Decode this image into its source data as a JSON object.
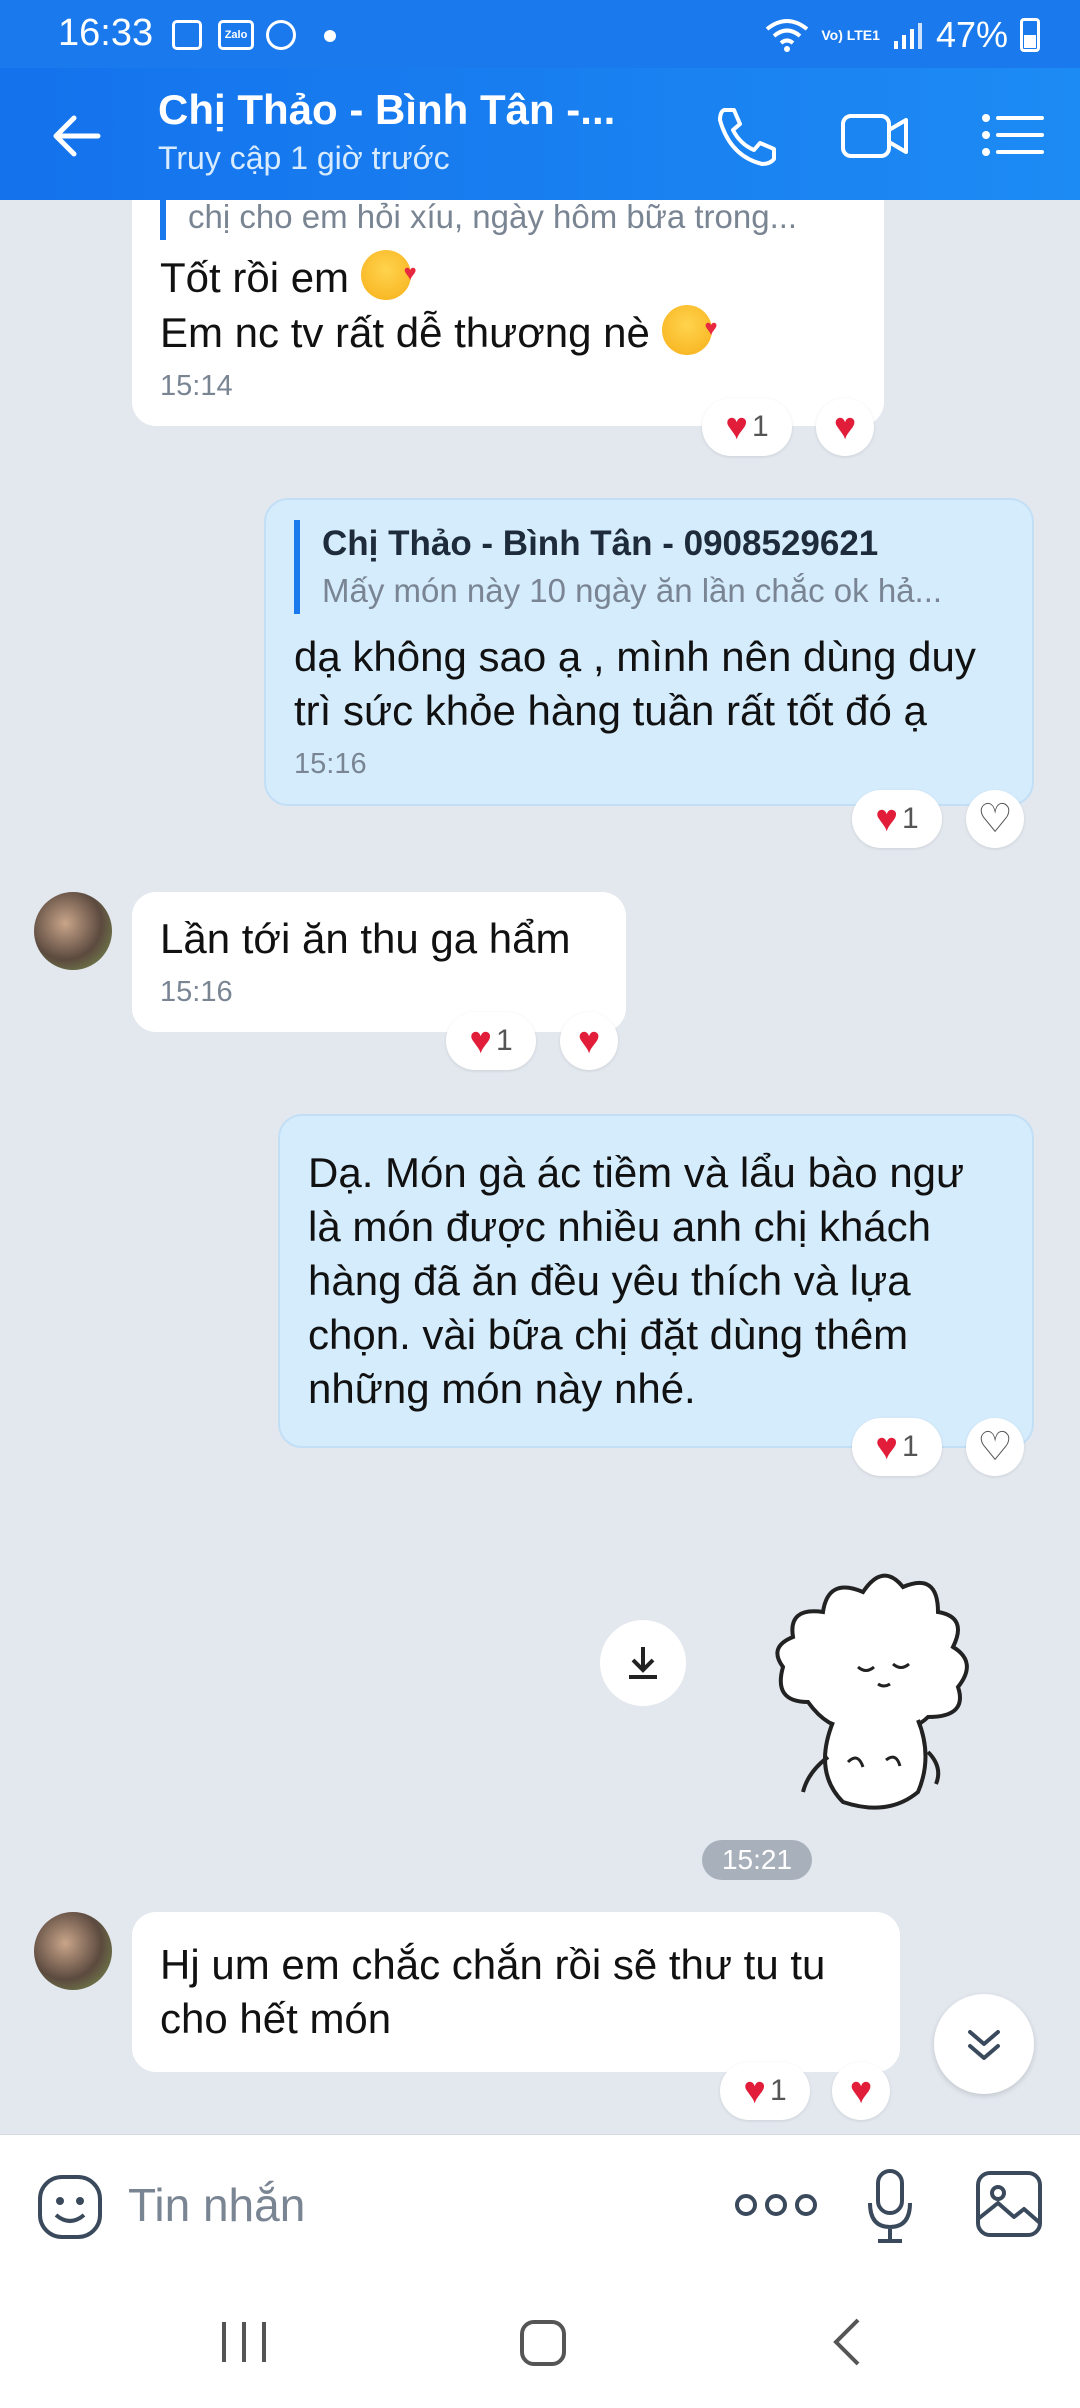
{
  "status_bar": {
    "time": "16:33",
    "zalo_label": "Zalo",
    "lte": "Vo) LTE1",
    "battery": "47%"
  },
  "header": {
    "title": "Chị Thảo  - Bình Tân -...",
    "subtitle": "Truy cập 1 giờ trước"
  },
  "messages": [
    {
      "quote_partial": "chị cho em hỏi xíu, ngày hôm bữa trong...",
      "lines": [
        "Tốt rồi em",
        "Em nc tv rất dễ thương nè"
      ],
      "time": "15:14",
      "reaction_count": "1"
    },
    {
      "quote_name": "Chị Thảo  - Bình Tân - 0908529621",
      "quote_text": "Mấy món này 10 ngày ăn lần chắc ok hả...",
      "text": "dạ không sao ạ , mình nên dùng duy trì sức khỏe hàng tuần rất tốt đó ạ",
      "time": "15:16",
      "reaction_count": "1"
    },
    {
      "text": "Lần tới ăn thu ga hẩm",
      "time": "15:16",
      "reaction_count": "1"
    },
    {
      "text": "Dạ. Món gà ác tiềm và lẩu bào ngư là món được nhiều anh chị khách hàng đã ăn đều yêu thích và lựa chọn. vài bữa chị đặt dùng thêm những món này nhé.",
      "reaction_count": "1"
    },
    {
      "text": "Hj um em chắc chắn rồi sẽ thư tu tu cho hết món",
      "reaction_count": "1"
    }
  ],
  "sticker_time": "15:21",
  "input": {
    "placeholder": "Tin nhắn"
  },
  "icons": [
    "back-arrow",
    "phone",
    "video",
    "list-menu",
    "emoji",
    "more-dots",
    "microphone",
    "image",
    "download",
    "chevron-double-down",
    "heart"
  ],
  "colors": {
    "header": "#1a79ec",
    "outgoing_bubble": "#d5ecfd",
    "incoming_bubble": "#ffffff",
    "background": "#e3e8ef",
    "heart": "#e11d3a"
  }
}
